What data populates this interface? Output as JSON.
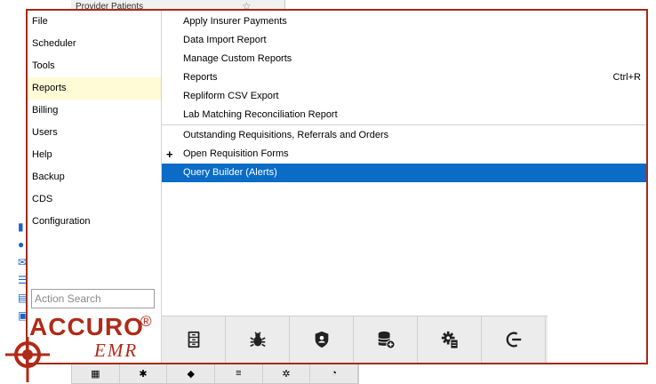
{
  "background": {
    "panel_text": "Provider Patients",
    "bottom_icons": [
      "cabinet-icon",
      "bug-icon",
      "shield-user-icon",
      "database-add-icon",
      "gear-doc-icon",
      "logout-icon"
    ]
  },
  "left_menu": {
    "items": [
      {
        "label": "File"
      },
      {
        "label": "Scheduler"
      },
      {
        "label": "Tools"
      },
      {
        "label": "Reports",
        "active": true
      },
      {
        "label": "Billing"
      },
      {
        "label": "Users"
      },
      {
        "label": "Help"
      },
      {
        "label": "Backup"
      },
      {
        "label": "CDS"
      },
      {
        "label": "Configuration"
      }
    ],
    "search_placeholder": "Action Search"
  },
  "submenu": {
    "items": [
      {
        "label": "Apply Insurer Payments"
      },
      {
        "label": "Data Import Report"
      },
      {
        "label": "Manage Custom Reports"
      },
      {
        "label": "Reports",
        "shortcut": "Ctrl+R"
      },
      {
        "label": "Repliform CSV Export"
      },
      {
        "label": "Lab Matching Reconciliation Report"
      },
      {
        "label": "Outstanding Requisitions, Referrals and Orders"
      },
      {
        "label": "Open Requisition Forms",
        "prefix": "+"
      },
      {
        "label": "Query Builder (Alerts)",
        "selected": true
      }
    ]
  },
  "toolbar": {
    "icons": [
      "cabinet-icon",
      "bug-icon",
      "shield-user-icon",
      "database-add-icon",
      "gear-doc-icon",
      "logout-icon"
    ]
  },
  "logo": {
    "brand": "ACCURO",
    "reg": "®",
    "sub": "EMR"
  },
  "colors": {
    "accent": "#a52a1a",
    "selection": "#0a6cc7",
    "active_bg": "#fffbd6"
  }
}
